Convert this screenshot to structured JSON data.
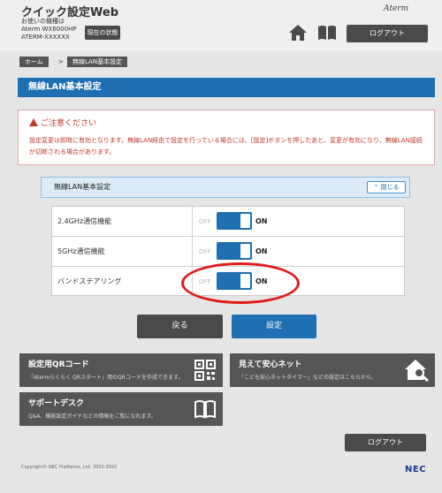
{
  "header": {
    "app_title": "クイック設定Web",
    "device_line1": "お使いの機種は",
    "device_line2": "Aterm WX6000HP",
    "device_line3": "ATERM-XXXXXX",
    "status_button": "現在の状態",
    "brand": "Aterm",
    "home_icon": "home-icon",
    "manual_icon": "book-icon",
    "logout_label": "ログアウト"
  },
  "breadcrumb": {
    "home": "ホーム",
    "separator": ">",
    "current": "無線LAN基本設定"
  },
  "page_title": "無線LAN基本設定",
  "notice": {
    "title": "ご注意ください",
    "text": "設定変更は即時に有効となります。無線LAN経由で設定を行っている場合には、[設定]ボタンを押したあと、変更が有効になり、無線LAN接続が切断される場合があります。",
    "color": "#c0392b"
  },
  "section": {
    "title": "無線LAN基本設定",
    "close_label": "閉じる"
  },
  "settings": [
    {
      "label": "2.4GHz通信機能",
      "off": "OFF",
      "on": "ON",
      "state": "ON"
    },
    {
      "label": "5GHz通信機能",
      "off": "OFF",
      "on": "ON",
      "state": "ON"
    },
    {
      "label": "バンドステアリング",
      "off": "OFF",
      "on": "ON",
      "state": "ON"
    }
  ],
  "actions": {
    "back": "戻る",
    "apply": "設定"
  },
  "cards": [
    {
      "title": "設定用QRコード",
      "desc": "「Atermらくらく QRスタート」用のQRコードを作成できます。",
      "icon": "qr-code-icon"
    },
    {
      "title": "見えて安心ネット",
      "desc": "「こども安心ネットタイマー」などの設定はこちらから。",
      "icon": "house-search-icon"
    },
    {
      "title": "サポートデスク",
      "desc": "Q&A、機能設定ガイドなどの情報をご覧になれます。",
      "icon": "book-icon"
    }
  ],
  "footer": {
    "logout_label": "ログアウト",
    "copyright": "Copyright© NEC Platforms, Ltd. 2001-2020",
    "logo": "NEC"
  },
  "colors": {
    "accent": "#1f6fb3",
    "button_dark": "#4a4a4a",
    "highlight": "#e01b1b"
  }
}
